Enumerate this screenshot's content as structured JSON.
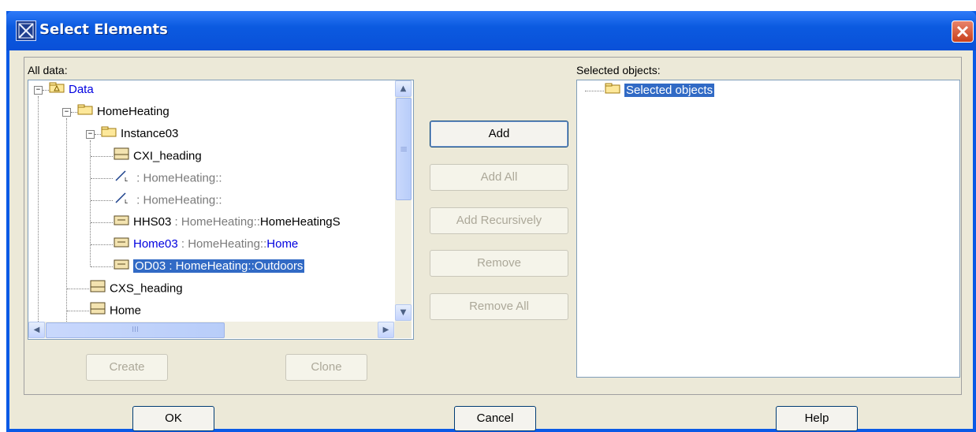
{
  "window": {
    "title": "Select Elements"
  },
  "left": {
    "label": "All data:",
    "tree": [
      {
        "name": "Data",
        "style": "blue"
      },
      {
        "name": "HomeHeating"
      },
      {
        "name": "Instance03"
      },
      {
        "name": "CXI_heading"
      },
      {
        "name": " : HomeHeating::",
        "style": "gray"
      },
      {
        "name": " : HomeHeating::",
        "style": "gray"
      },
      {
        "name": "HHS03",
        "type": " : HomeHeating::",
        "type2": "HomeHeatingS"
      },
      {
        "name": "Home03",
        "type": " : HomeHeating::",
        "type2": "Home"
      },
      {
        "name": "OD03 : HomeHeating::Outdoors"
      },
      {
        "name": "CXS_heading"
      },
      {
        "name": "Home"
      }
    ],
    "create_label": "Create",
    "clone_label": "Clone"
  },
  "buttons": {
    "add": "Add",
    "add_all": "Add All",
    "add_recursively": "Add Recursively",
    "remove": "Remove",
    "remove_all": "Remove All"
  },
  "right": {
    "label": "Selected objects:",
    "root": "Selected objects"
  },
  "footer": {
    "ok": "OK",
    "cancel": "Cancel",
    "help": "Help"
  },
  "colors": {
    "titlebar": "#0a5ae6",
    "dialog_bg": "#ece9d8",
    "selection": "#316ac5",
    "link_blue": "#0000e0"
  },
  "scrollbar_h_glyph": "III",
  "scrollbar_v_glyph": "≡"
}
